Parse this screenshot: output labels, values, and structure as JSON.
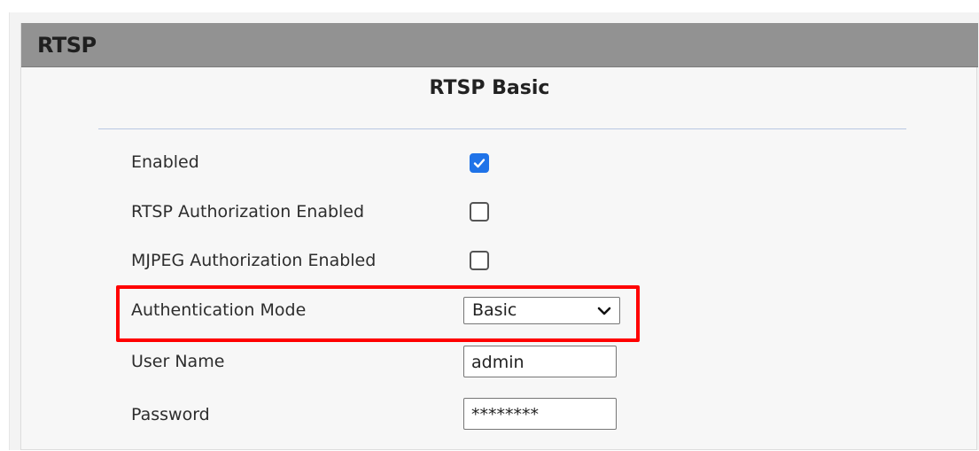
{
  "panel": {
    "title": "RTSP"
  },
  "section": {
    "title": "RTSP Basic"
  },
  "fields": {
    "enabled": {
      "label": "Enabled",
      "checked": true
    },
    "rtsp_auth": {
      "label": "RTSP Authorization Enabled",
      "checked": false
    },
    "mjpeg_auth": {
      "label": "MJPEG Authorization Enabled",
      "checked": false
    },
    "auth_mode": {
      "label": "Authentication Mode",
      "value": "Basic"
    },
    "user_name": {
      "label": "User Name",
      "value": "admin"
    },
    "password": {
      "label": "Password",
      "value": "********"
    }
  },
  "icons": {
    "checkmark": "check-icon",
    "dropdown": "chevron-down-icon"
  },
  "colors": {
    "header_bg": "#929292",
    "checkbox_accent": "#1f73e8",
    "highlight": "#ff0000",
    "divider": "#b8c7e3"
  }
}
